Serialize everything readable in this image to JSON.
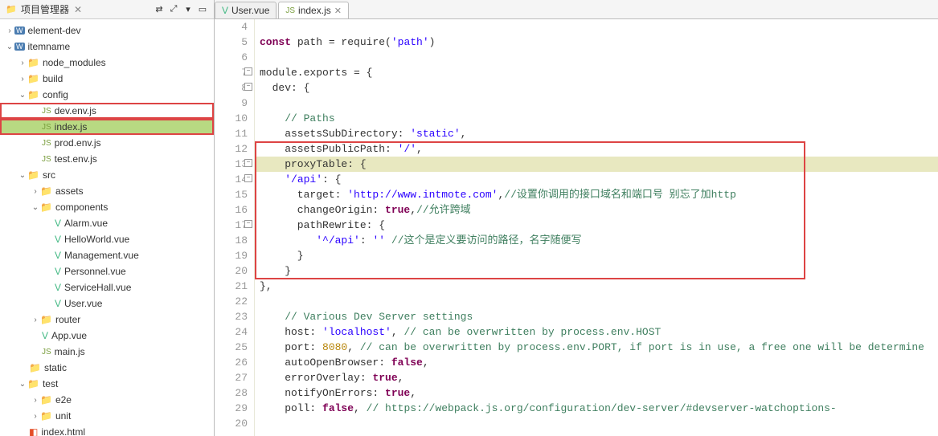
{
  "sidebar": {
    "title": "项目管理器",
    "items": {
      "element_dev": "element-dev",
      "itemname": "itemname",
      "node_modules": "node_modules",
      "build": "build",
      "config": "config",
      "dev_env": "dev.env.js",
      "indexjs": "index.js",
      "prod_env": "prod.env.js",
      "test_env": "test.env.js",
      "src": "src",
      "assets": "assets",
      "components": "components",
      "alarm": "Alarm.vue",
      "hello": "HelloWorld.vue",
      "mgmt": "Management.vue",
      "pers": "Personnel.vue",
      "srvh": "ServiceHall.vue",
      "user": "User.vue",
      "router": "router",
      "appvue": "App.vue",
      "mainjs": "main.js",
      "static_": "static",
      "test": "test",
      "e2e": "e2e",
      "unit": "unit",
      "indexhtml": "index.html"
    }
  },
  "tabs": {
    "t1": "User.vue",
    "t2": "index.js"
  },
  "code": {
    "l5a": "const",
    "l5b": " path = require(",
    "l5c": "'path'",
    "l5d": ")",
    "l7a": "module.exports = {",
    "l8a": "  dev: {",
    "l10a": "    ",
    "l10b": "// Paths",
    "l11a": "    assetsSubDirectory: ",
    "l11b": "'static'",
    "l11c": ",",
    "l12a": "    assetsPublicPath: ",
    "l12b": "'/'",
    "l12c": ",",
    "l13a": "    proxyTable: {",
    "l14a": "    ",
    "l14b": "'/api'",
    "l14c": ": {",
    "l15a": "      target: ",
    "l15b": "'http://www.intmote.com'",
    "l15c": ",",
    "l15d": "//设置你调用的接口域名和端口号 别忘了加http",
    "l16a": "      changeOrigin: ",
    "l16b": "true",
    "l16c": ",",
    "l16d": "//允许跨域",
    "l17a": "      pathRewrite: {",
    "l18a": "         ",
    "l18b": "'^/api'",
    "l18c": ": ",
    "l18d": "''",
    "l18e": " ",
    "l18f": "//这个是定义要访问的路径，名字随便写",
    "l19a": "      }",
    "l20a": "    }",
    "l21a": "},",
    "l23a": "    ",
    "l23b": "// Various Dev Server settings",
    "l24a": "    host: ",
    "l24b": "'localhost'",
    "l24c": ", ",
    "l24d": "// can be overwritten by process.env.HOST",
    "l25a": "    port: ",
    "l25b": "8080",
    "l25c": ", ",
    "l25d": "// can be overwritten by process.env.PORT, if port is in use, a free one will be determine",
    "l26a": "    autoOpenBrowser: ",
    "l26b": "false",
    "l26c": ",",
    "l27a": "    errorOverlay: ",
    "l27b": "true",
    "l27c": ",",
    "l28a": "    notifyOnErrors: ",
    "l28b": "true",
    "l28c": ",",
    "l29a": "    poll: ",
    "l29b": "false",
    "l29c": ", ",
    "l29d": "// https://webpack.js.org/configuration/dev-server/#devserver-watchoptions-"
  }
}
